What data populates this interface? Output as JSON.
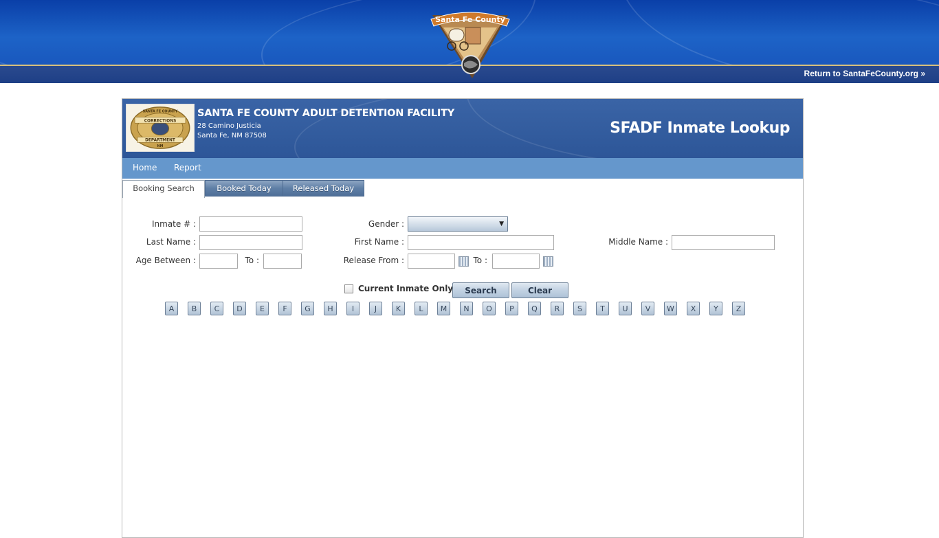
{
  "banner": {
    "return_link": "Return to SantaFeCounty.org »",
    "seal_text": "Santa Fe County"
  },
  "facility": {
    "name": "SANTA FE COUNTY ADULT DETENTION FACILITY",
    "address_line1": "28 Camino Justicia",
    "address_line2": "Santa Fe, NM 87508",
    "badge_text_top": "SANTA FE COUNTY",
    "badge_text_mid": "CORRECTIONS",
    "badge_text_bottom": "DEPARTMENT",
    "badge_text_nm": "NM"
  },
  "page_title": "SFADF Inmate Lookup",
  "menu": {
    "home": "Home",
    "report": "Report"
  },
  "tabs": {
    "booking_search": "Booking Search",
    "booked_today": "Booked Today",
    "released_today": "Released Today",
    "active": "Booking Search"
  },
  "form": {
    "inmate_label": "Inmate # :",
    "inmate_value": "",
    "gender_label": "Gender :",
    "gender_value": "",
    "last_name_label": "Last Name :",
    "last_name_value": "",
    "first_name_label": "First Name :",
    "first_name_value": "",
    "middle_name_label": "Middle Name :",
    "middle_name_value": "",
    "age_between_label": "Age Between :",
    "age_from_value": "",
    "age_to_label": "To :",
    "age_to_value": "",
    "release_from_label": "Release From :",
    "release_from_value": "",
    "release_to_label": "To :",
    "release_to_value": "",
    "current_inmate_label": "Current Inmate Only",
    "current_inmate_checked": false,
    "search_button": "Search",
    "clear_button": "Clear"
  },
  "letters": [
    "A",
    "B",
    "C",
    "D",
    "E",
    "F",
    "G",
    "H",
    "I",
    "J",
    "K",
    "L",
    "M",
    "N",
    "O",
    "P",
    "Q",
    "R",
    "S",
    "T",
    "U",
    "V",
    "W",
    "X",
    "Y",
    "Z"
  ],
  "colors": {
    "banner_blue": "#1d63c7",
    "header_blue": "#3a64a6",
    "menu_blue": "#6597cc",
    "gold_stripe": "#d8c07a"
  }
}
